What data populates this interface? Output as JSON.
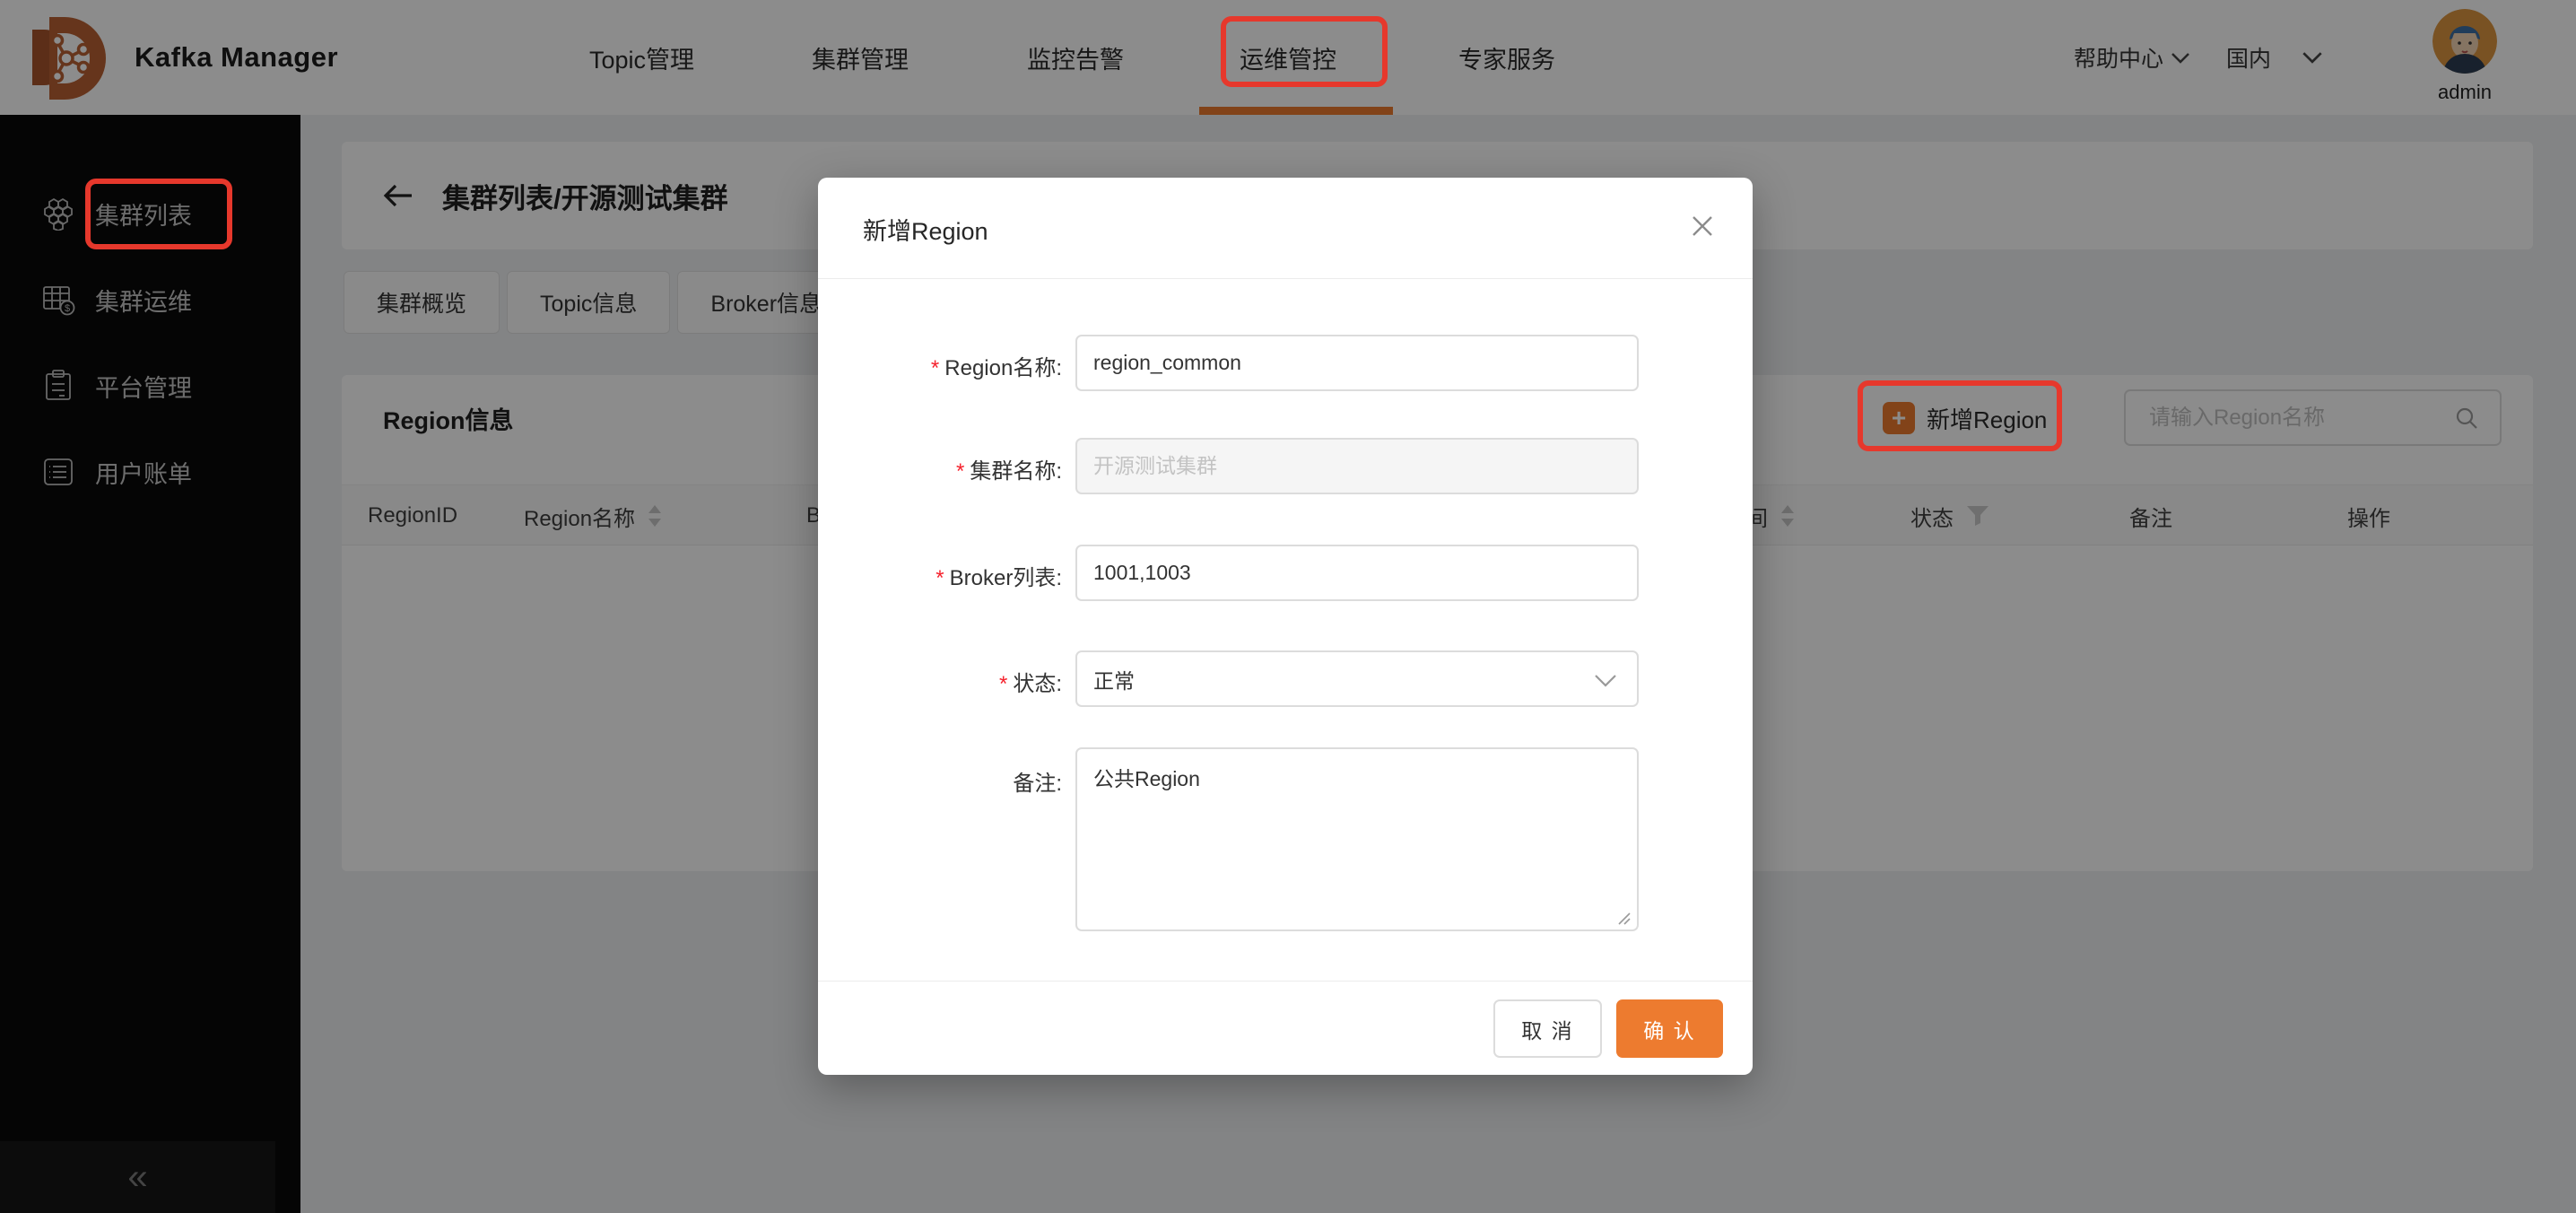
{
  "navbar": {
    "brand": "Kafka Manager",
    "items": [
      {
        "label": "Topic管理"
      },
      {
        "label": "集群管理"
      },
      {
        "label": "监控告警"
      },
      {
        "label": "运维管控"
      },
      {
        "label": "专家服务"
      }
    ],
    "active_item": "运维管控",
    "help": "帮助中心",
    "region": "国内",
    "username": "admin"
  },
  "sidebar": {
    "items": [
      {
        "label": "集群列表",
        "icon": "honeycomb-icon"
      },
      {
        "label": "集群运维",
        "icon": "ops-grid-icon"
      },
      {
        "label": "平台管理",
        "icon": "clipboard-icon"
      },
      {
        "label": "用户账单",
        "icon": "bill-list-icon"
      }
    ],
    "collapse_icon": "«"
  },
  "page": {
    "title": "集群列表/开源测试集群",
    "tabs": [
      "集群概览",
      "Topic信息",
      "Broker信息"
    ],
    "section_title": "Region信息",
    "add_button": "新增Region",
    "add_plus": "+",
    "search_placeholder": "请输入Region名称",
    "table_headers": [
      "RegionID",
      "Region名称",
      "B",
      "间",
      "状态",
      "备注",
      "操作"
    ]
  },
  "modal": {
    "title": "新增Region",
    "required_mark": "*",
    "fields": [
      {
        "label": "Region名称:",
        "value": "region_common"
      },
      {
        "label": "集群名称:",
        "placeholder": "开源测试集群"
      },
      {
        "label": "Broker列表:",
        "value": "1001,1003"
      },
      {
        "label": "状态:",
        "value": "正常"
      },
      {
        "label": "备注:",
        "value": "公共Region"
      }
    ],
    "cancel": "取 消",
    "confirm": "确 认"
  },
  "colors": {
    "accent": "#ED7B2F",
    "annotation": "#E6382C",
    "sidebar_bg": "#0A0A0A"
  }
}
